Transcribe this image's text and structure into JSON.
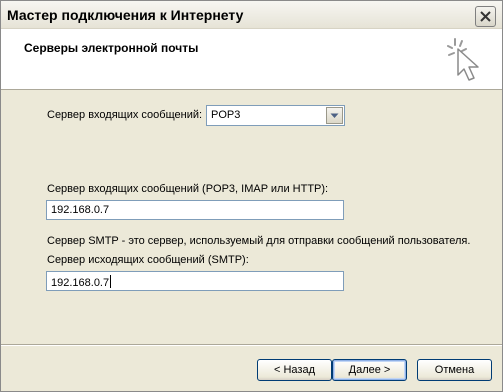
{
  "window": {
    "title": "Мастер подключения к Интернету",
    "icons": {
      "close": "close-icon",
      "wizard": "wizard-cursor-icon"
    }
  },
  "header": {
    "title": "Серверы электронной почты"
  },
  "form": {
    "incoming_type_label": "Сервер входящих сообщений:",
    "incoming_type_value": "POP3",
    "incoming_type_options_icon": "chevron-down-icon",
    "incoming_server_label": "Сервер входящих сообщений (POP3, IMAP или HTTP):",
    "incoming_server_value": "192.168.0.7",
    "smtp_note": "Сервер SMTP - это сервер, используемый для отправки сообщений  пользователя.",
    "outgoing_server_label": "Сервер исходящих сообщений (SMTP):",
    "outgoing_server_value": "192.168.0.7"
  },
  "buttons": {
    "back": "< Назад",
    "next": "Далее >",
    "cancel": "Отмена"
  }
}
